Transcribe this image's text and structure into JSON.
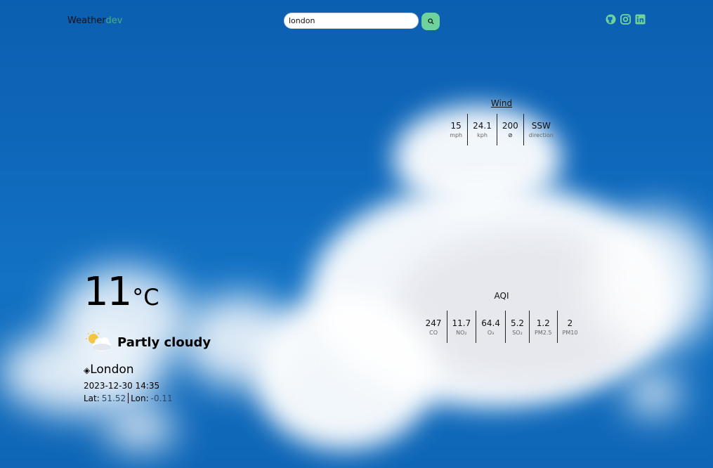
{
  "navbar": {
    "brand_main": "Weather",
    "brand_accent": "dev",
    "search_value": "london",
    "icons": [
      "search-icon",
      "github-icon",
      "instagram-icon",
      "linkedin-icon"
    ],
    "accent_color": "#6fd29a"
  },
  "wind": {
    "title": "Wind",
    "items": [
      {
        "value": "15",
        "unit": "mph"
      },
      {
        "value": "24.1",
        "unit": "kph"
      },
      {
        "value": "200",
        "unit": "⊘"
      },
      {
        "value": "SSW",
        "unit": "direction"
      }
    ]
  },
  "aqi": {
    "title": "AQI",
    "items": [
      {
        "value": "247",
        "unit": "CO"
      },
      {
        "value": "11.7",
        "unit": "NO₂"
      },
      {
        "value": "64.4",
        "unit": "O₃"
      },
      {
        "value": "5.2",
        "unit": "SO₂"
      },
      {
        "value": "1.2",
        "unit": "PM2.5"
      },
      {
        "value": "2",
        "unit": "PM10"
      }
    ]
  },
  "current": {
    "temp": "11",
    "temp_unit": "°C",
    "condition": "Partly cloudy",
    "condition_icon": "partly-cloudy-icon",
    "location": "London",
    "location_marker": "◈",
    "datetime": "2023-12-30 14:35",
    "lat_label": "Lat:",
    "lat_value": "51.52",
    "lon_label": "Lon:",
    "lon_value": "-0.11"
  }
}
